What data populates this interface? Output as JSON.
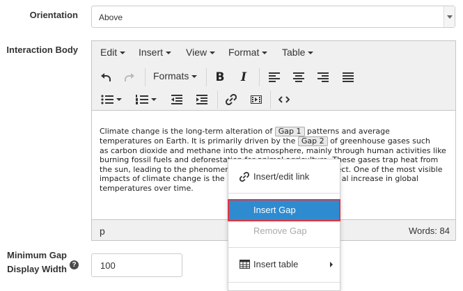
{
  "form": {
    "orientation_label": "Orientation",
    "orientation_value": "Above",
    "interaction_body_label": "Interaction Body",
    "min_gap_label": "Minimum Gap Display Width",
    "min_gap_value": "100",
    "help_icon_glyph": "?"
  },
  "editor": {
    "menubar": [
      "Edit",
      "Insert",
      "View",
      "Format",
      "Table"
    ],
    "formats_label": "Formats",
    "icons": [
      "undo-icon",
      "redo-icon",
      "bold-icon",
      "italic-icon",
      "align-left-icon",
      "align-center-icon",
      "align-right-icon",
      "align-justify-icon",
      "bullet-list-icon",
      "numbered-list-icon",
      "outdent-icon",
      "indent-icon",
      "link-icon",
      "media-icon",
      "code-icon"
    ],
    "content": {
      "line1_before": "Climate change is the long-term alteration of ",
      "gap1": "Gap 1",
      "line1_after": " patterns and average",
      "line2_before": "temperatures on Earth. It is primarily driven by the ",
      "gap2": "Gap 2",
      "line2_after": " of greenhouse gases such",
      "line3": "as carbon dioxide and methane into the atmosphere, mainly through human activities like",
      "line4": "burning fossil fuels and deforestation for animal agriculture. These gases trap heat from",
      "line5_before": "the sun, leading to the phenomer",
      "line5_after": "fect. One of the most visible",
      "line6_before": "impacts of climate change is the",
      "line6_after": "al increase in global",
      "line7": "temperatures over time."
    },
    "status_path": "p",
    "word_count": "Words: 84"
  },
  "context_menu": {
    "insert_edit_link": "Insert/edit link",
    "insert_gap": "Insert Gap",
    "remove_gap": "Remove Gap",
    "insert_table": "Insert table"
  },
  "colors": {
    "highlight": "#2f8bd0",
    "highlight_border": "#e0343f"
  }
}
